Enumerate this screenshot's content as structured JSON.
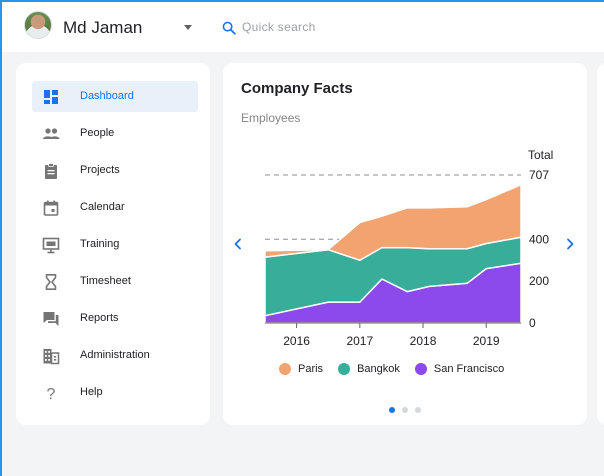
{
  "header": {
    "user_name": "Md Jaman",
    "search_placeholder": "Quick search"
  },
  "sidebar": {
    "items": [
      {
        "label": "Dashboard",
        "icon": "dashboard-icon",
        "active": true
      },
      {
        "label": "People",
        "icon": "people-icon"
      },
      {
        "label": "Projects",
        "icon": "clipboard-icon"
      },
      {
        "label": "Calendar",
        "icon": "calendar-icon"
      },
      {
        "label": "Training",
        "icon": "presentation-icon"
      },
      {
        "label": "Timesheet",
        "icon": "hourglass-icon"
      },
      {
        "label": "Reports",
        "icon": "chat-icon"
      },
      {
        "label": "Administration",
        "icon": "building-icon"
      },
      {
        "label": "Help",
        "icon": "help-icon"
      }
    ]
  },
  "card": {
    "title": "Company Facts",
    "subtitle": "Employees",
    "carousel": {
      "pages": 3,
      "active": 0
    }
  },
  "colors": {
    "accent": "#1a73e8",
    "paris": "#f3a36f",
    "bangkok": "#38ad99",
    "san_francisco": "#8c49ec"
  },
  "chart_data": {
    "type": "area",
    "stacked": true,
    "x": [
      2015.5,
      2016.5,
      2017.0,
      2017.35,
      2017.75,
      2018.1,
      2018.7,
      2019.0,
      2019.55
    ],
    "x_ticks": [
      "2016",
      "2017",
      "2018",
      "2019"
    ],
    "y_axis_title": "Total",
    "y_ticks": [
      0,
      200,
      400,
      707
    ],
    "ylim": [
      0,
      707
    ],
    "series": [
      {
        "name": "San Francisco",
        "values": [
          35,
          100,
          100,
          210,
          150,
          175,
          190,
          260,
          285
        ]
      },
      {
        "name": "Bangkok",
        "values": [
          280,
          250,
          200,
          150,
          210,
          180,
          165,
          120,
          125
        ]
      },
      {
        "name": "Paris",
        "values": [
          30,
          0,
          180,
          150,
          190,
          195,
          200,
          210,
          250
        ]
      }
    ],
    "reference_lines": [
      707,
      400
    ],
    "legend": "bottom"
  }
}
